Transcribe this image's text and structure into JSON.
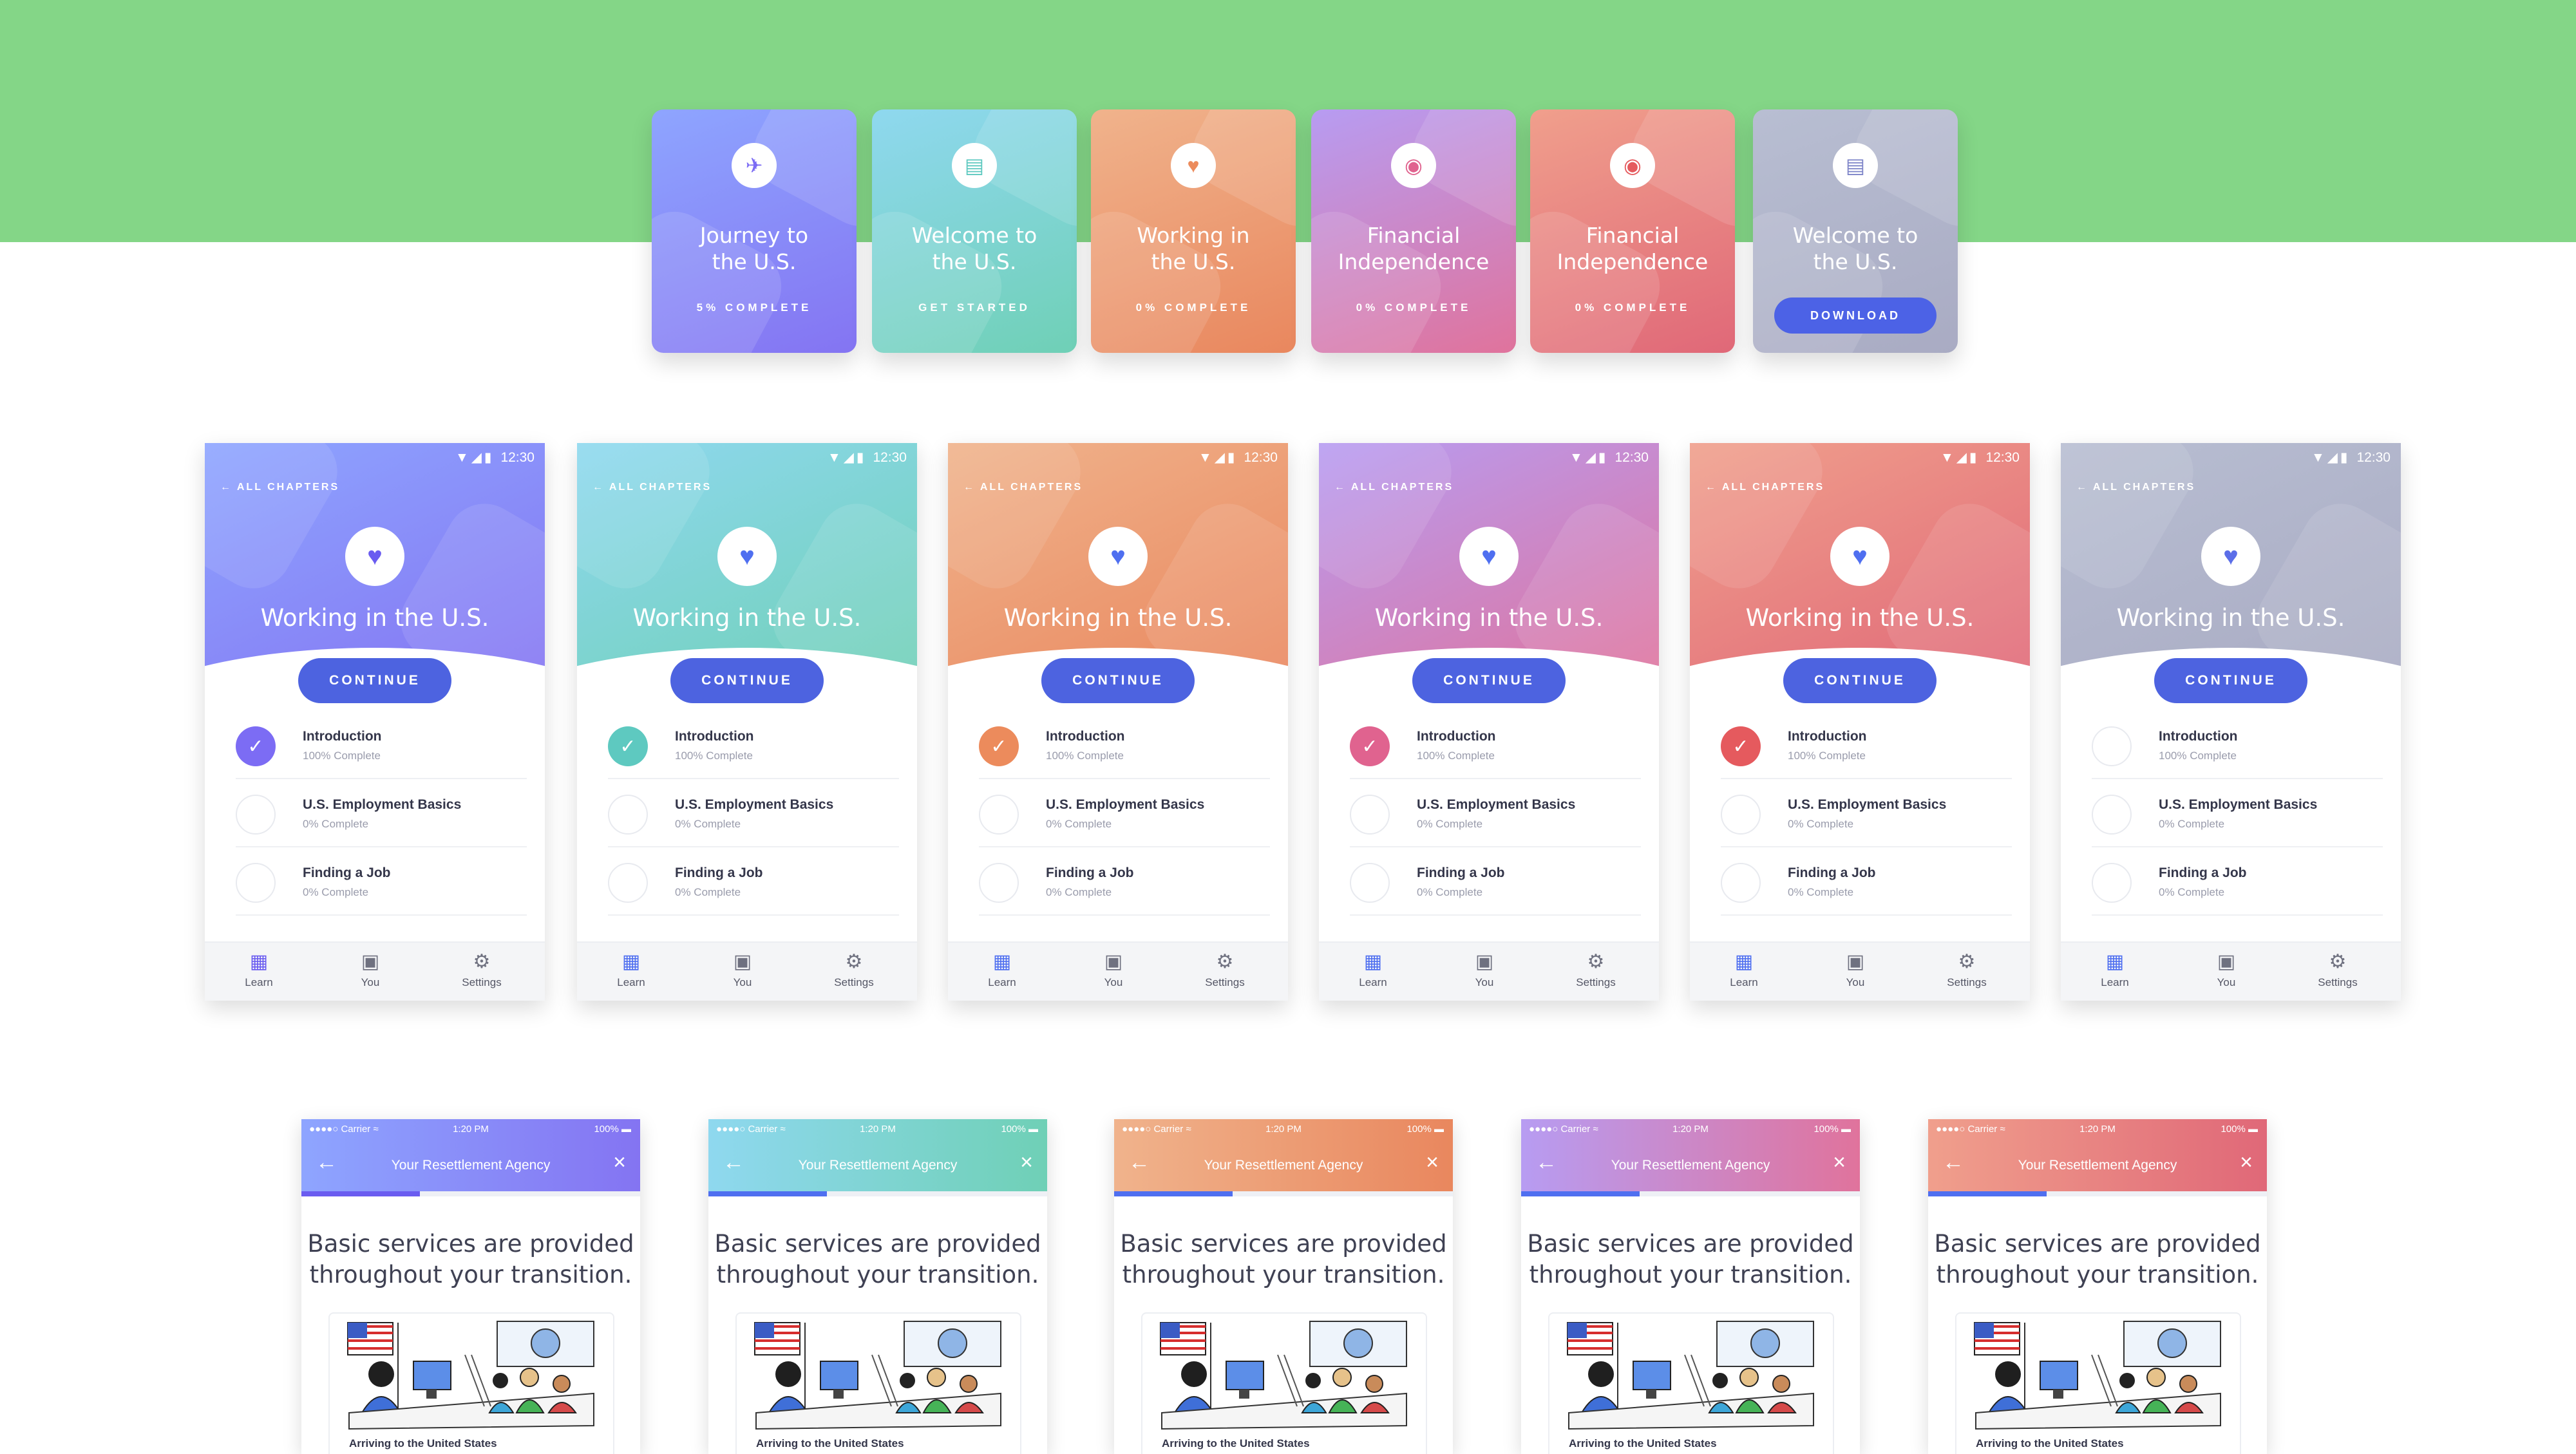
{
  "colors": {
    "background_band": "#84d687",
    "button_blue": "#4d63e0",
    "themes": [
      {
        "name": "purple",
        "from": "#8ea5ff",
        "to": "#8474f2",
        "check": "#7c6cf4",
        "nav": "#6a5cf0"
      },
      {
        "name": "teal",
        "from": "#8fd8ef",
        "to": "#6fd0b6",
        "check": "#5ec9c0",
        "nav": "#4f6ff0"
      },
      {
        "name": "orange",
        "from": "#f0b38c",
        "to": "#e9875e",
        "check": "#ec8b5c",
        "nav": "#4f6ff0"
      },
      {
        "name": "violet",
        "from": "#b79cf2",
        "to": "#e0739c",
        "check": "#e0638f",
        "nav": "#4f6ff0"
      },
      {
        "name": "red",
        "from": "#f09f8c",
        "to": "#e06878",
        "check": "#e55a5e",
        "nav": "#4f6ff0"
      },
      {
        "name": "grey",
        "from": "#b8bed2",
        "to": "#a9abc3",
        "check": "#ffffff",
        "nav": "#4f6ff0"
      }
    ]
  },
  "cards": [
    {
      "title_1": "Journey to",
      "title_2": "the U.S.",
      "status": "5% COMPLETE",
      "icon": "airplane-icon"
    },
    {
      "title_1": "Welcome to",
      "title_2": "the U.S.",
      "status": "GET STARTED",
      "icon": "flag-icon"
    },
    {
      "title_1": "Working in",
      "title_2": "the U.S.",
      "status": "0% COMPLETE",
      "icon": "handshake-icon"
    },
    {
      "title_1": "Financial",
      "title_2": "Independence",
      "status": "0% COMPLETE",
      "icon": "money-icon"
    },
    {
      "title_1": "Financial",
      "title_2": "Independence",
      "status": "0% COMPLETE",
      "icon": "money-icon"
    },
    {
      "title_1": "Welcome to",
      "title_2": "the U.S.",
      "status": "DOWNLOAD",
      "icon": "flag-icon"
    }
  ],
  "phone": {
    "status_time": "12:30",
    "back_label": "ALL CHAPTERS",
    "title": "Working in the U.S.",
    "continue_label": "CONTINUE",
    "lessons": [
      {
        "name": "Introduction",
        "progress": "100% Complete"
      },
      {
        "name": "U.S. Employment Basics",
        "progress": "0% Complete"
      },
      {
        "name": "Finding a Job",
        "progress": "0% Complete"
      }
    ],
    "nav": [
      {
        "label": "Learn",
        "icon": "book-icon"
      },
      {
        "label": "You",
        "icon": "profile-icon"
      },
      {
        "label": "Settings",
        "icon": "gear-icon"
      }
    ]
  },
  "iphone": {
    "carrier": "●●●●○ Carrier ≈",
    "time": "1:20 PM",
    "battery": "100%",
    "title": "Your Resettlement Agency",
    "body_line_1": "Basic services are provided",
    "body_line_2": "throughout your transition.",
    "caption": "Arriving to the United States"
  }
}
